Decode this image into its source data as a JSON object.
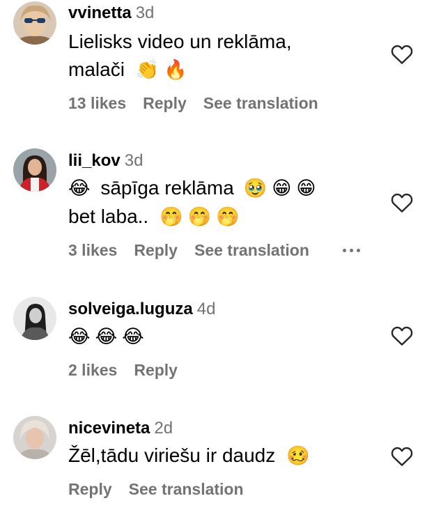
{
  "comments": [
    {
      "username": "vvinetta",
      "time": "3d",
      "text_line1": "Lielisks video un reklāma,",
      "text_line2": "malači",
      "emojis_line2": [
        "👏",
        "🔥"
      ],
      "likes": "13 likes",
      "reply": "Reply",
      "translation": "See translation",
      "emoji_icons": [
        "clapping-hands-icon",
        "fire-icon"
      ]
    },
    {
      "username": "lii_kov",
      "time": "3d",
      "text_line1": "sāpīga reklāma",
      "emojis_before_line1": [
        "😂"
      ],
      "emojis_after_line1": [
        "🥹",
        "😁",
        "😁"
      ],
      "text_line2": "bet laba..",
      "emojis_line2": [
        "🤭",
        "🤭",
        "🤭"
      ],
      "likes": "3 likes",
      "reply": "Reply",
      "translation": "See translation"
    },
    {
      "username": "solveiga.luguza",
      "time": "4d",
      "emojis_line1": [
        "😂",
        "😂",
        "😂"
      ],
      "likes": "2 likes",
      "reply": "Reply"
    },
    {
      "username": "nicevineta",
      "time": "2d",
      "text_line1": "Žēl,tādu viriešu ir daudz",
      "emojis_after_line1": [
        "🥴"
      ],
      "reply": "Reply",
      "translation": "See translation"
    }
  ],
  "colors": {
    "text": "#000000",
    "secondary": "#737373",
    "background": "#ffffff"
  }
}
